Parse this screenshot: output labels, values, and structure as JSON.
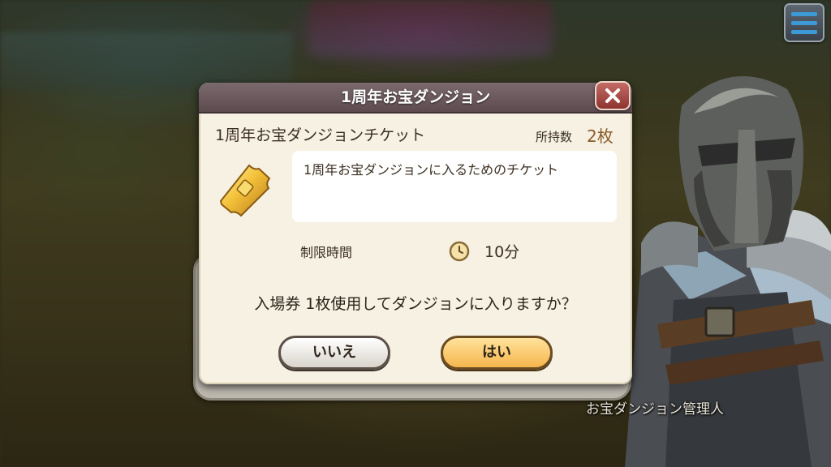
{
  "npc": {
    "name": "お宝ダンジョン管理人"
  },
  "dialog": {
    "title": "1周年お宝ダンジョン",
    "item_name": "1周年お宝ダンジョンチケット",
    "owned_label": "所持数",
    "owned_value": "2枚",
    "description": "1周年お宝ダンジョンに入るためのチケット",
    "time_limit_label": "制限時間",
    "time_limit_value": "10分",
    "question": "入場券 1枚使用してダンジョンに入りますか？",
    "no_label": "いいえ",
    "yes_label": "はい"
  },
  "icons": {
    "menu": "hamburger-menu-icon",
    "close": "close-x-icon",
    "ticket": "gold-ticket-icon",
    "clock": "clock-icon"
  },
  "colors": {
    "header": "#6b5a5e",
    "yes_button": "#f5b64d",
    "menu_lines": "#3d9ad6",
    "owned_count": "#8b5a2a"
  }
}
